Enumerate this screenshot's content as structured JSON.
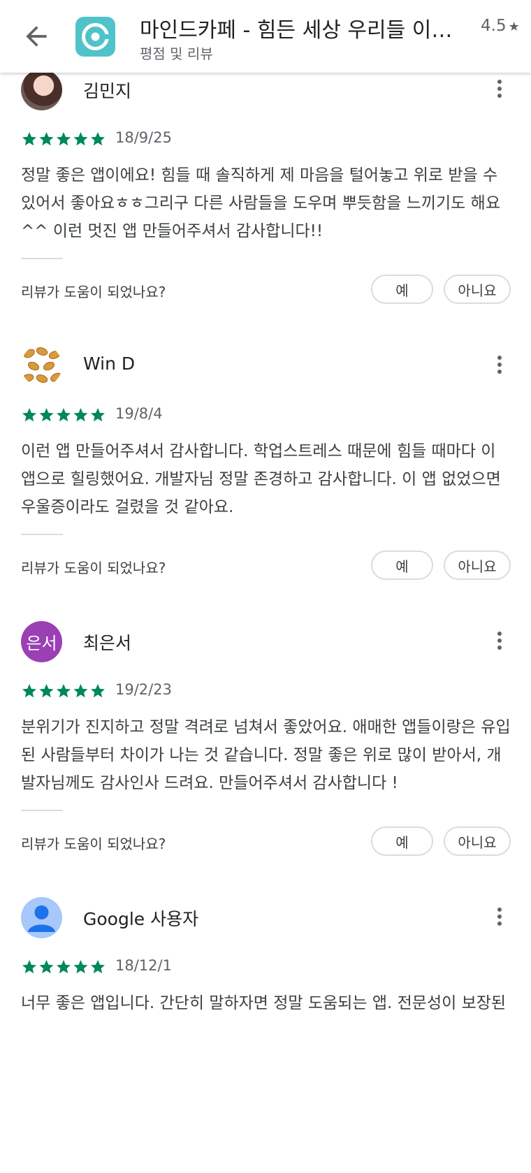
{
  "header": {
    "title": "마인드카페 - 힘든 세상 우리들 이야기 - 익명 커뮤니티, 고민 상담, 힐링",
    "subtitle": "평점 및 리뷰",
    "rating": "4.5",
    "rating_star": "★"
  },
  "helpful_prompt": "리뷰가 도움이 되었나요?",
  "yes_label": "예",
  "no_label": "아니요",
  "colors": {
    "star": "#01875f",
    "avatar_choi": "#9b3fb5",
    "avatar_google": "#a8c7fa"
  },
  "reviews": [
    {
      "name": "김민지",
      "stars": 5,
      "date": "18/9/25",
      "text": "정말 좋은 앱이에요! 힘들 때 솔직하게 제 마음을 털어놓고 위로 받을 수 있어서 좋아요ㅎㅎ그리구 다른 사람들을 도우며 뿌듯함을 느끼기도 해요^^ 이런 멋진 앱 만들어주셔서 감사합니다!!"
    },
    {
      "name": "Win D",
      "stars": 5,
      "date": "19/8/4",
      "text": "이런 앱 만들어주셔서 감사합니다. 학업스트레스 때문에 힘들 때마다 이 앱으로 힐링했어요. 개발자님 정말 존경하고 감사합니다. 이 앱 없었으면 우울증이라도 걸렸을 것 같아요."
    },
    {
      "name": "최은서",
      "avatar_text": "은서",
      "stars": 5,
      "date": "19/2/23",
      "text": "분위기가 진지하고 정말 격려로 넘쳐서 좋았어요. 애매한 앱들이랑은 유입된 사람들부터 차이가 나는 것 같습니다. 정말 좋은 위로 많이 받아서, 개발자님께도 감사인사 드려요. 만들어주셔서 감사합니다 !"
    },
    {
      "name": "Google 사용자",
      "stars": 5,
      "date": "18/12/1",
      "text": "너무 좋은 앱입니다. 간단히 말하자면 정말 도움되는 앱. 전문성이 보장된"
    }
  ]
}
